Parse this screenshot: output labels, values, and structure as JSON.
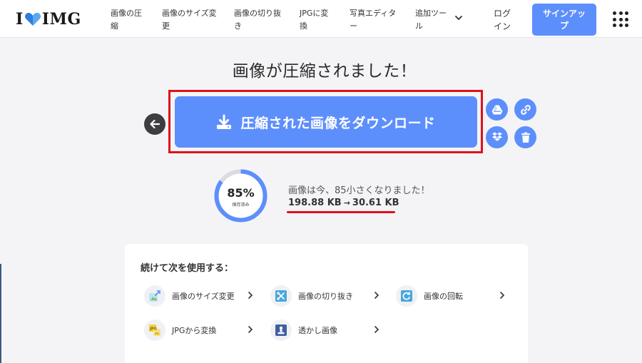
{
  "header": {
    "logo_left": "I",
    "logo_right": "IMG",
    "nav": [
      {
        "line1": "画像の圧",
        "line2": "縮"
      },
      {
        "line1": "画像のサイズ変",
        "line2": "更"
      },
      {
        "line1": "画像の切り抜",
        "line2": "き"
      },
      {
        "line1": "JPGに変",
        "line2": "換"
      },
      {
        "line1": "写真エディタ",
        "line2": "ー"
      },
      {
        "line1": "追加ツー",
        "line2": "ル"
      }
    ],
    "login": {
      "line1": "ログ",
      "line2": "イン"
    },
    "signup": {
      "line1": "サインアッ",
      "line2": "プ"
    }
  },
  "main": {
    "title": "画像が圧縮されました！",
    "download_label": "圧縮された画像をダウンロード",
    "saved_percent": "85%",
    "saved_label": "保存済み",
    "saved_fraction": 0.85,
    "saved_message": "画像は今、85小さくなりました！",
    "size_before": "198.88 KB",
    "size_arrow": "→",
    "size_after": "30.61 KB"
  },
  "continue": {
    "title": "続けて次を使用する：",
    "tools": [
      {
        "label": "画像のサイズ変更",
        "icon": "resize-icon"
      },
      {
        "label": "画像の切り抜き",
        "icon": "crop-icon"
      },
      {
        "label": "画像の回転",
        "icon": "rotate-icon"
      },
      {
        "label": "JPGから変換",
        "icon": "convert-icon"
      },
      {
        "label": "透かし画像",
        "icon": "watermark-icon"
      }
    ]
  },
  "colors": {
    "accent": "#5d8ffc",
    "highlight": "#e0101b",
    "dark": "#3d3d42"
  }
}
